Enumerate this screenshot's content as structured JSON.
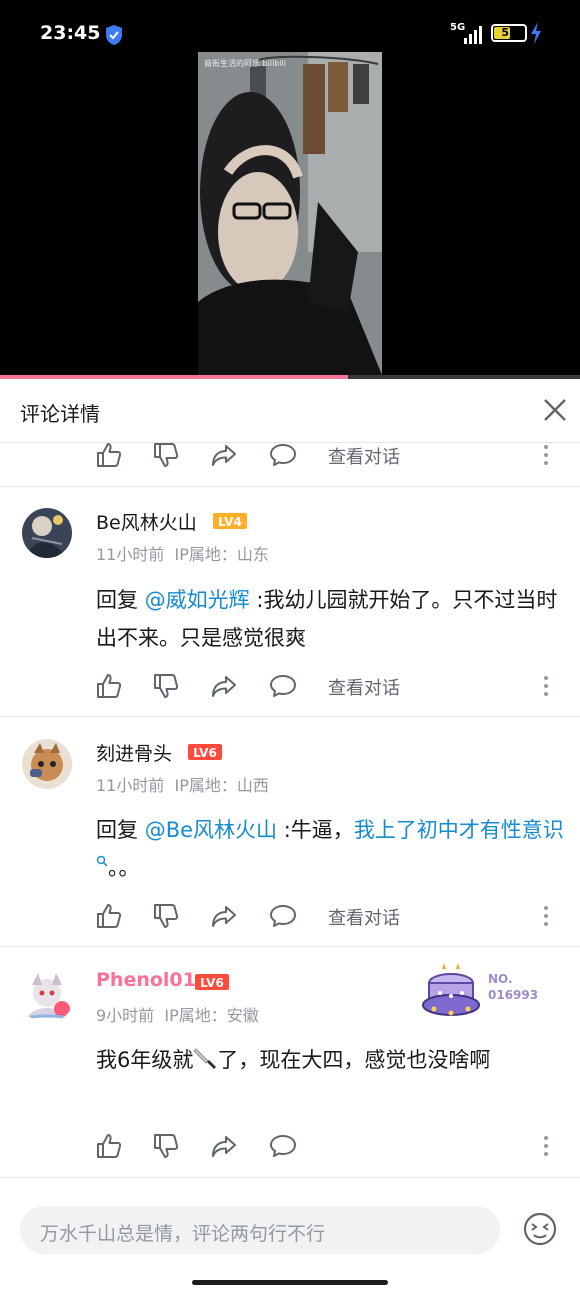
{
  "status": {
    "time": "23:45",
    "network": "5G",
    "battery": "51"
  },
  "video": {
    "watermark": "商街生活的阿乐 bilibili",
    "progress": 0.6
  },
  "panel": {
    "title": "评论详情"
  },
  "actions": {
    "view_conversation": "查看对话"
  },
  "comments": [
    {
      "username": "Be风林火山",
      "level": "LV4",
      "time": "11小时前",
      "ip_label": "IP属地：",
      "ip": "山东",
      "reply_prefix": "回复 ",
      "mention": "@威如光辉",
      "text": " :我幼儿园就开始了。只不过当时出不来。只是感觉很爽"
    },
    {
      "username": "刻进骨头",
      "level": "LV6",
      "time": "11小时前",
      "ip_label": "IP属地：",
      "ip": "山西",
      "reply_prefix": "回复 ",
      "mention": "@Be风林火山",
      "text": " :牛逼，",
      "link_text": "我上了初中才有性意识",
      "suffix": "。。"
    },
    {
      "username": "Phenol01",
      "level": "LV6",
      "time": "9小时前",
      "ip_label": "IP属地：",
      "ip": "安徽",
      "text_before": "我6年级就",
      "text_after": "了，现在大四，感觉也没啥啊",
      "badge_line1": "NO.",
      "badge_line2": "016993"
    }
  ],
  "input": {
    "placeholder": "万水千山总是情，评论两句行不行"
  },
  "colors": {
    "accent": "#fb7299",
    "link": "#178bcf",
    "secondary": "#9499a0",
    "lv4": "#ffb027",
    "lv6": "#ff4a3c"
  },
  "icons": [
    "shield-icon",
    "signal-icon",
    "battery-icon",
    "charging-icon",
    "close-icon",
    "like-icon",
    "dislike-icon",
    "share-icon",
    "reply-icon",
    "more-icon",
    "search-icon",
    "knife-emoji",
    "emoji-icon"
  ]
}
